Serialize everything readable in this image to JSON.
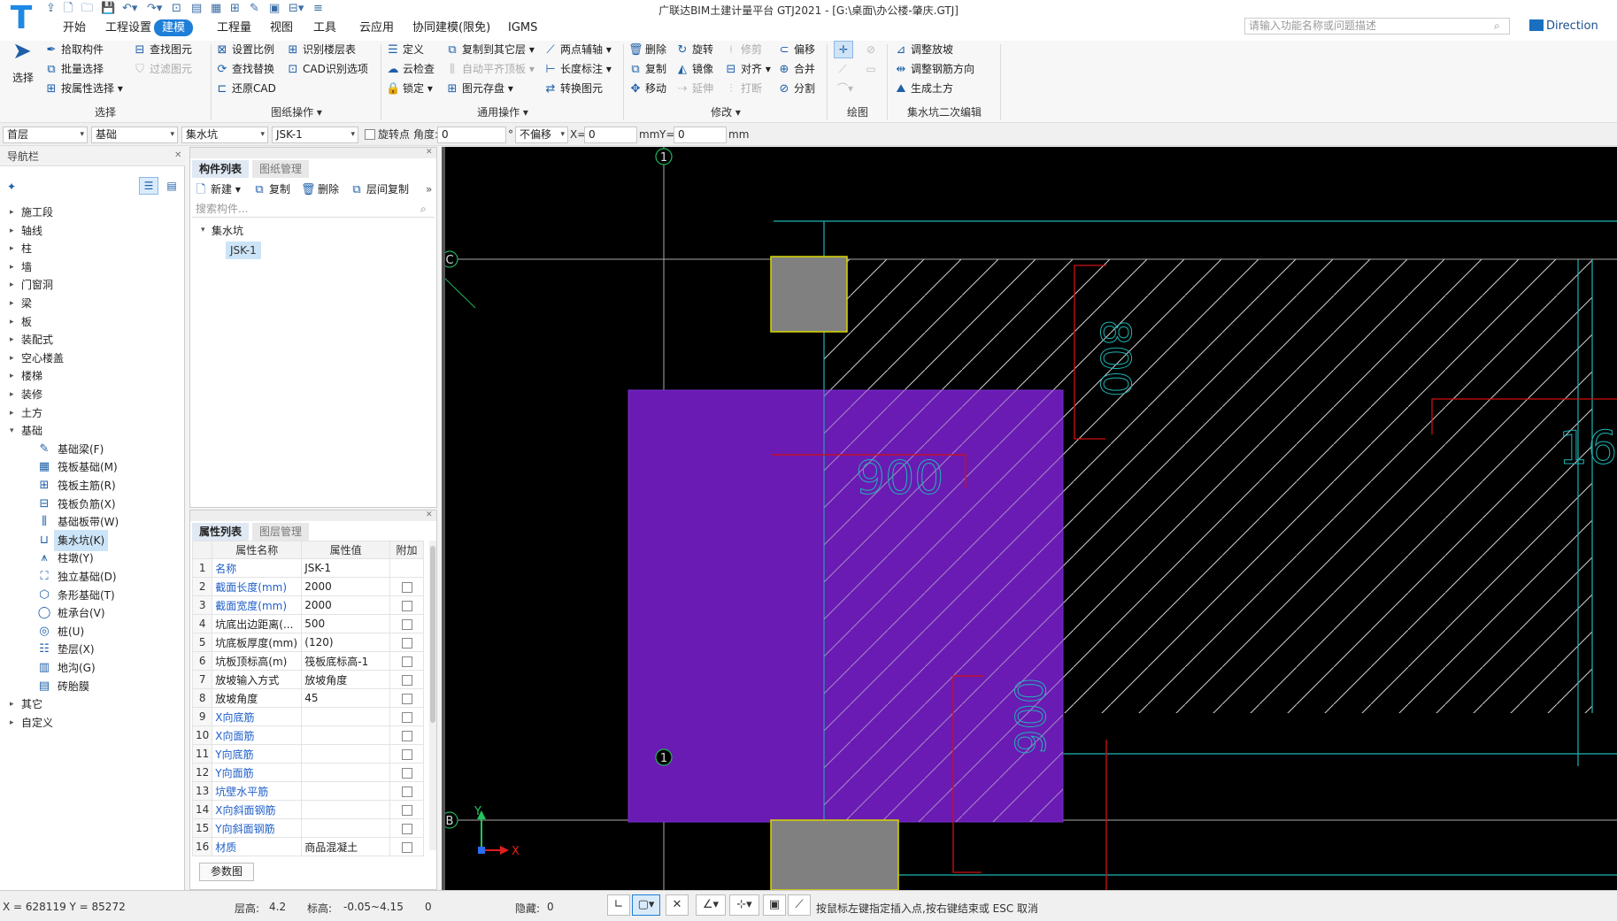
{
  "app": {
    "title": "广联达BIM土建计量平台 GTJ2021 - [G:\\桌面\\办公楼-肇庆.GTJ]",
    "search_placeholder": "请输入功能名称或问题描述",
    "direction_label": "Direction"
  },
  "menu": [
    "开始",
    "工程设置",
    "建模",
    "工程量",
    "视图",
    "工具",
    "云应用",
    "协同建模(限免)",
    "IGMS"
  ],
  "menu_active": "建模",
  "ribbon": {
    "select": {
      "big": "选择",
      "items": [
        "拾取构件",
        "批量选择",
        "按属性选择",
        "查找图元",
        "过滤图元"
      ],
      "group": "选择"
    },
    "drawing_ops": {
      "items": [
        "设置比例",
        "查找替换",
        "还原CAD",
        "识别楼层表",
        "CAD识别选项"
      ],
      "group": "图纸操作"
    },
    "common_ops": {
      "items": [
        "定义",
        "云检查",
        "锁定",
        "复制到其它层",
        "自动平齐顶板",
        "图元存盘",
        "两点辅轴",
        "长度标注",
        "转换图元"
      ],
      "group": "通用操作"
    },
    "modify": {
      "items": [
        "删除",
        "复制",
        "移动",
        "旋转",
        "镜像",
        "延伸",
        "修剪",
        "对齐",
        "打断",
        "偏移",
        "合并",
        "分割"
      ],
      "group": "修改"
    },
    "draw": {
      "group": "绘图"
    },
    "pit_edit": {
      "items": [
        "调整放坡",
        "调整钢筋方向",
        "生成土方"
      ],
      "group": "集水坑二次编辑"
    }
  },
  "combobar": {
    "floor": "首层",
    "category": "基础",
    "type": "集水坑",
    "component": "JSK-1",
    "rotate_label": "旋转点",
    "angle_label": "角度:",
    "angle_value": "0",
    "angle_unit": "°",
    "offset": "不偏移",
    "x_label": "X=",
    "x_value": "0",
    "x_unit": "mm",
    "y_label": "Y=",
    "y_value": "0",
    "y_unit": "mm"
  },
  "nav": {
    "title": "导航栏",
    "groups_top": [
      "施工段",
      "轴线",
      "柱",
      "墙",
      "门窗洞",
      "梁",
      "板",
      "装配式",
      "空心楼盖",
      "楼梯",
      "装修",
      "土方",
      "基础"
    ],
    "foundation_items": [
      "基础梁(F)",
      "筏板基础(M)",
      "筏板主筋(R)",
      "筏板负筋(X)",
      "基础板带(W)",
      "集水坑(K)",
      "柱墩(Y)",
      "独立基础(D)",
      "条形基础(T)",
      "桩承台(V)",
      "桩(U)",
      "垫层(X)",
      "地沟(G)",
      "砖胎膜"
    ],
    "selected": "集水坑(K)",
    "groups_bottom": [
      "其它",
      "自定义"
    ]
  },
  "component_list": {
    "tabs": [
      "构件列表",
      "图纸管理"
    ],
    "toolbar": [
      "新建",
      "复制",
      "删除",
      "层间复制"
    ],
    "search_placeholder": "搜索构件...",
    "tree_root": "集水坑",
    "tree_child": "JSK-1"
  },
  "property_list": {
    "tabs": [
      "属性列表",
      "图层管理"
    ],
    "headers": [
      "属性名称",
      "属性值",
      "附加"
    ],
    "rows": [
      {
        "n": "1",
        "k": "名称",
        "v": "JSK-1",
        "link": true,
        "chk": false
      },
      {
        "n": "2",
        "k": "截面长度(mm)",
        "v": "2000",
        "link": true,
        "chk": true
      },
      {
        "n": "3",
        "k": "截面宽度(mm)",
        "v": "2000",
        "link": true,
        "chk": true
      },
      {
        "n": "4",
        "k": "坑底出边距离(...",
        "v": "500",
        "link": false,
        "chk": true
      },
      {
        "n": "5",
        "k": "坑底板厚度(mm)",
        "v": "(120)",
        "link": false,
        "chk": true
      },
      {
        "n": "6",
        "k": "坑板顶标高(m)",
        "v": "筏板底标高-1",
        "link": false,
        "chk": true
      },
      {
        "n": "7",
        "k": "放坡输入方式",
        "v": "放坡角度",
        "link": false,
        "chk": true
      },
      {
        "n": "8",
        "k": "放坡角度",
        "v": "45",
        "link": false,
        "chk": true
      },
      {
        "n": "9",
        "k": "X向底筋",
        "v": "",
        "link": true,
        "chk": true
      },
      {
        "n": "10",
        "k": "X向面筋",
        "v": "",
        "link": true,
        "chk": true
      },
      {
        "n": "11",
        "k": "Y向底筋",
        "v": "",
        "link": true,
        "chk": true
      },
      {
        "n": "12",
        "k": "Y向面筋",
        "v": "",
        "link": true,
        "chk": true
      },
      {
        "n": "13",
        "k": "坑壁水平筋",
        "v": "",
        "link": true,
        "chk": true
      },
      {
        "n": "14",
        "k": "X向斜面钢筋",
        "v": "",
        "link": true,
        "chk": true
      },
      {
        "n": "15",
        "k": "Y向斜面钢筋",
        "v": "",
        "link": true,
        "chk": true
      },
      {
        "n": "16",
        "k": "材质",
        "v": "商品混凝土",
        "link": true,
        "chk": true
      }
    ],
    "param_button": "参数图"
  },
  "canvas": {
    "axis_top": "1",
    "axis_bottom": "1",
    "axis_c": "C",
    "axis_b": "B",
    "dim_900": "900",
    "dim_800": "800",
    "dim_006": "006",
    "dim_16": "16",
    "ucs_x": "X",
    "ucs_y": "Y",
    "colors": {
      "pit": "#6a1bb3",
      "column": "#808080",
      "grid": "#1fb5b5",
      "redline": "#d01010",
      "axis": "#aaaaaa"
    }
  },
  "status": {
    "coords": "X = 628119 Y = 85272",
    "floor_height_label": "层高:",
    "floor_height": "4.2",
    "elev_label": "标高:",
    "elev": "-0.05~4.15",
    "zero": "0",
    "hidden_label": "隐藏:",
    "hidden": "0",
    "hint": "按鼠标左键指定插入点,按右键结束或 ESC 取消"
  }
}
